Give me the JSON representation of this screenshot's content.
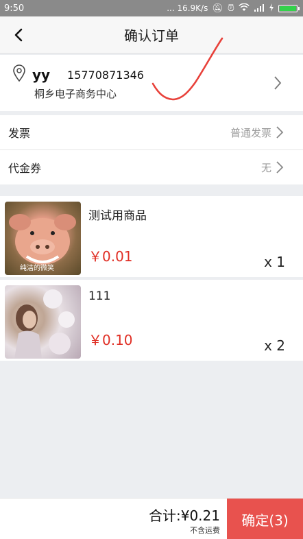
{
  "status_bar": {
    "time": "9:50",
    "network_speed": "... 16.9K/s",
    "icons": [
      "mute-icon",
      "alarm-icon",
      "wifi-icon",
      "signal-icon",
      "charging-icon",
      "battery-icon"
    ],
    "battery_color": "#33d24b"
  },
  "header": {
    "title": "确认订单",
    "back_icon": "back-arrow-icon"
  },
  "address": {
    "name": "yy",
    "phone": "15770871346",
    "line": "桐乡电子商务中心",
    "icon": "location-pin-icon",
    "annotation_color": "#e8413a"
  },
  "invoice": {
    "label": "发票",
    "value": "普通发票"
  },
  "voucher": {
    "label": "代金券",
    "value": "无"
  },
  "products": [
    {
      "name": "测试用商品",
      "price": "￥0.01",
      "quantity": "x 1",
      "image_caption": "纯洁的微笑",
      "image_icon": "pig-photo"
    },
    {
      "name": "111",
      "price": "￥0.10",
      "quantity": "x 2",
      "image_icon": "woman-photo"
    }
  ],
  "footer": {
    "total": "合计:¥0.21",
    "freight_note": "不含运费",
    "confirm_label": "确定(3)",
    "confirm_color": "#e8524e",
    "price_color": "#e02e24"
  }
}
